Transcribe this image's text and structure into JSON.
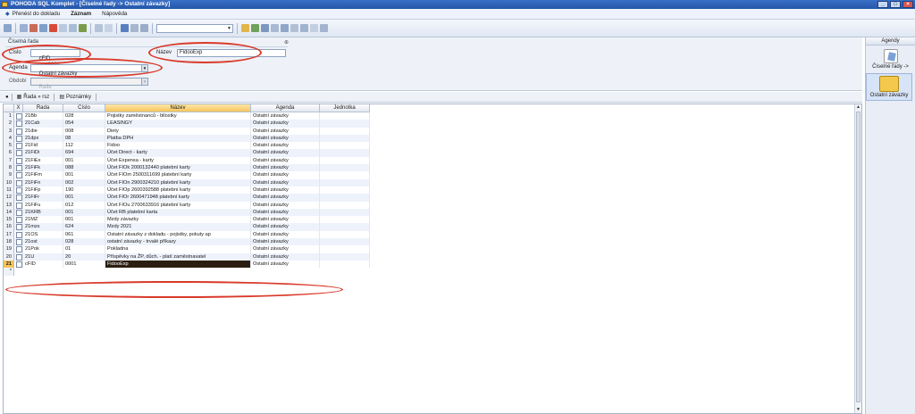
{
  "window": {
    "title": "POHODA SQL Komplet - [Číselné řady -> Ostatní závazky]"
  },
  "menu": [
    {
      "label": "Přenést do dokladu",
      "bold": false
    },
    {
      "label": "Záznam",
      "bold": true
    },
    {
      "label": "Nápověda",
      "bold": false
    }
  ],
  "panel": {
    "title": "Číselná řada",
    "cislo_label": "Číslo",
    "cislo_prefix": "cFID",
    "cislo_value": "0001",
    "nazev_label": "Název",
    "nazev_value": "FidooExp",
    "agenda_label": "Agenda",
    "agenda_value": "Ostatní závazky",
    "obdobi_label": "Období",
    "obdobi_value": "Rafie"
  },
  "subtabs": [
    {
      "label": "Řada » rsz"
    },
    {
      "label": "Poznámky"
    }
  ],
  "grid": {
    "columns": [
      "X",
      "Řada",
      "Číslo",
      "Název",
      "Agenda",
      "Jednotka"
    ],
    "rows": [
      {
        "n": "1",
        "rada": "21Bb",
        "cislo": "028",
        "nazev": "Pojistky zaměstnanců - bllostky",
        "agenda": "Ostatní závazky"
      },
      {
        "n": "2",
        "rada": "21Cab",
        "cislo": "054",
        "nazev": "LEASINGY",
        "agenda": "Ostatní závazky"
      },
      {
        "n": "3",
        "rada": "21die",
        "cislo": "008",
        "nazev": "Diety",
        "agenda": "Ostatní závazky"
      },
      {
        "n": "4",
        "rada": "21dpx",
        "cislo": "08",
        "nazev": "Platba DPH",
        "agenda": "Ostatní závazky"
      },
      {
        "n": "5",
        "rada": "21Fid",
        "cislo": "112",
        "nazev": "Fidoo",
        "agenda": "Ostatní závazky"
      },
      {
        "n": "6",
        "rada": "21FiDi",
        "cislo": "694",
        "nazev": "Účet Direct - karty",
        "agenda": "Ostatní závazky"
      },
      {
        "n": "7",
        "rada": "21FiEx",
        "cislo": "001",
        "nazev": "Účet Expensa - karty",
        "agenda": "Ostatní závazky"
      },
      {
        "n": "8",
        "rada": "21FiFk",
        "cislo": "088",
        "nazev": "Účet FIOk 2000132440 platební karty",
        "agenda": "Ostatní závazky"
      },
      {
        "n": "9",
        "rada": "21FiFm",
        "cislo": "001",
        "nazev": "Účet FIOm 2500311699 platební karty",
        "agenda": "Ostatní závazky"
      },
      {
        "n": "10",
        "rada": "21FiFn",
        "cislo": "002",
        "nazev": "Účet FIOn 2900324210 platební karty",
        "agenda": "Ostatní závazky"
      },
      {
        "n": "11",
        "rada": "21FiFp",
        "cislo": "190",
        "nazev": "Účet FIOp 2600392588 platební karty",
        "agenda": "Ostatní závazky"
      },
      {
        "n": "12",
        "rada": "21FiFr",
        "cislo": "001",
        "nazev": "Účet FIOr 2600471948 platební karty",
        "agenda": "Ostatní závazky"
      },
      {
        "n": "13",
        "rada": "21FiFu",
        "cislo": "012",
        "nazev": "Účet FIOu 2700633916 platební karty",
        "agenda": "Ostatní závazky"
      },
      {
        "n": "14",
        "rada": "21KRB",
        "cislo": "001",
        "nazev": "Účet RB platební karta",
        "agenda": "Ostatní závazky"
      },
      {
        "n": "15",
        "rada": "21MZ",
        "cislo": "001",
        "nazev": "Mzdy závazky",
        "agenda": "Ostatní závazky"
      },
      {
        "n": "16",
        "rada": "21mzs",
        "cislo": "624",
        "nazev": "Mzdy 2021",
        "agenda": "Ostatní závazky"
      },
      {
        "n": "17",
        "rada": "21OS",
        "cislo": "061",
        "nazev": "Ostatní závazky z dokladu - pojistky, pokuty ap",
        "agenda": "Ostatní závazky"
      },
      {
        "n": "18",
        "rada": "21ost",
        "cislo": "028",
        "nazev": "ostatní závazky - trvalé příkazy",
        "agenda": "Ostatní závazky"
      },
      {
        "n": "19",
        "rada": "21Pok",
        "cislo": "01",
        "nazev": "Pokladna",
        "agenda": "Ostatní závazky"
      },
      {
        "n": "20",
        "rada": "21U",
        "cislo": "20",
        "nazev": "Příspěvky na ŽP, důch. - platí zaměstnavatel",
        "agenda": "Ostatní závazky"
      },
      {
        "n": "21",
        "rada": "cFID",
        "cislo": "0001",
        "nazev": "FidooExp",
        "agenda": "Ostatní závazky"
      }
    ],
    "new_row_marker": "*"
  },
  "sidebar": {
    "header": "Agendy",
    "items": [
      {
        "label": "Číselné řady ->"
      },
      {
        "label": "Ostatní závazky"
      }
    ]
  },
  "colors": {
    "title_bar": "#2456a8",
    "highlight_ring": "#d93a2a",
    "selected_header": "#f5c45a",
    "active_cell": "#2b1e10"
  }
}
